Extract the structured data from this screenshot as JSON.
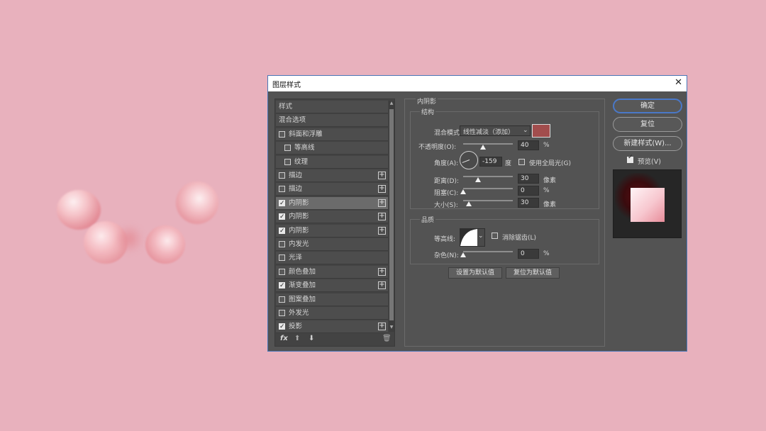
{
  "dialog": {
    "title": "图层样式",
    "close_glyph": "✕"
  },
  "styles_list": {
    "items": [
      {
        "label": "样式",
        "checkbox": false,
        "checked": false,
        "plus": false,
        "indent": 0,
        "selected": false
      },
      {
        "label": "混合选项",
        "checkbox": false,
        "checked": false,
        "plus": false,
        "indent": 0,
        "selected": false
      },
      {
        "label": "斜面和浮雕",
        "checkbox": true,
        "checked": false,
        "plus": false,
        "indent": 0,
        "selected": false
      },
      {
        "label": "等高线",
        "checkbox": true,
        "checked": false,
        "plus": false,
        "indent": 1,
        "selected": false
      },
      {
        "label": "纹理",
        "checkbox": true,
        "checked": false,
        "plus": false,
        "indent": 1,
        "selected": false
      },
      {
        "label": "描边",
        "checkbox": true,
        "checked": false,
        "plus": true,
        "indent": 0,
        "selected": false
      },
      {
        "label": "描边",
        "checkbox": true,
        "checked": false,
        "plus": true,
        "indent": 0,
        "selected": false
      },
      {
        "label": "内阴影",
        "checkbox": true,
        "checked": true,
        "plus": true,
        "indent": 0,
        "selected": true
      },
      {
        "label": "内阴影",
        "checkbox": true,
        "checked": true,
        "plus": true,
        "indent": 0,
        "selected": false
      },
      {
        "label": "内阴影",
        "checkbox": true,
        "checked": true,
        "plus": true,
        "indent": 0,
        "selected": false
      },
      {
        "label": "内发光",
        "checkbox": true,
        "checked": false,
        "plus": false,
        "indent": 0,
        "selected": false
      },
      {
        "label": "光泽",
        "checkbox": true,
        "checked": false,
        "plus": false,
        "indent": 0,
        "selected": false
      },
      {
        "label": "颜色叠加",
        "checkbox": true,
        "checked": false,
        "plus": true,
        "indent": 0,
        "selected": false
      },
      {
        "label": "渐变叠加",
        "checkbox": true,
        "checked": true,
        "plus": true,
        "indent": 0,
        "selected": false
      },
      {
        "label": "图案叠加",
        "checkbox": true,
        "checked": false,
        "plus": false,
        "indent": 0,
        "selected": false
      },
      {
        "label": "外发光",
        "checkbox": true,
        "checked": false,
        "plus": false,
        "indent": 0,
        "selected": false
      },
      {
        "label": "投影",
        "checkbox": true,
        "checked": true,
        "plus": true,
        "indent": 0,
        "selected": false
      }
    ],
    "fx_label": "fx",
    "up_glyph": "⬆",
    "down_glyph": "⬇",
    "trash_glyph": "🗑"
  },
  "inner_shadow": {
    "section_title": "内阴影",
    "structure_title": "结构",
    "blend_mode_label": "混合模式:",
    "blend_mode_value": "线性减淡（添加）",
    "shadow_color": "#a24d4d",
    "opacity_label": "不透明度(O):",
    "opacity_value": "40",
    "opacity_unit": "%",
    "opacity_fraction": 0.4,
    "angle_label": "角度(A):",
    "angle_value": "-159",
    "angle_unit": "度",
    "global_light_label": "使用全局光(G)",
    "distance_label": "距离(D):",
    "distance_value": "30",
    "distance_unit": "像素",
    "distance_fraction": 0.3,
    "choke_label": "阻塞(C):",
    "choke_value": "0",
    "choke_unit": "%",
    "choke_fraction": 0.0,
    "size_label": "大小(S):",
    "size_value": "30",
    "size_unit": "像素",
    "size_fraction": 0.12,
    "quality_title": "品质",
    "contour_label": "等高线:",
    "antialias_label": "消除锯齿(L)",
    "noise_label": "杂色(N):",
    "noise_value": "0",
    "noise_unit": "%",
    "noise_fraction": 0.0,
    "set_default_label": "设置为默认值",
    "reset_default_label": "复位为默认值"
  },
  "actions": {
    "ok_label": "确定",
    "reset_label": "复位",
    "new_style_label": "新建样式(W)...",
    "preview_label": "预览(V)",
    "preview_checked": true
  },
  "colors": {
    "canvas_background": "#e8b1bd",
    "dialog_background": "#535353",
    "accent_blue": "#4a78c8"
  }
}
